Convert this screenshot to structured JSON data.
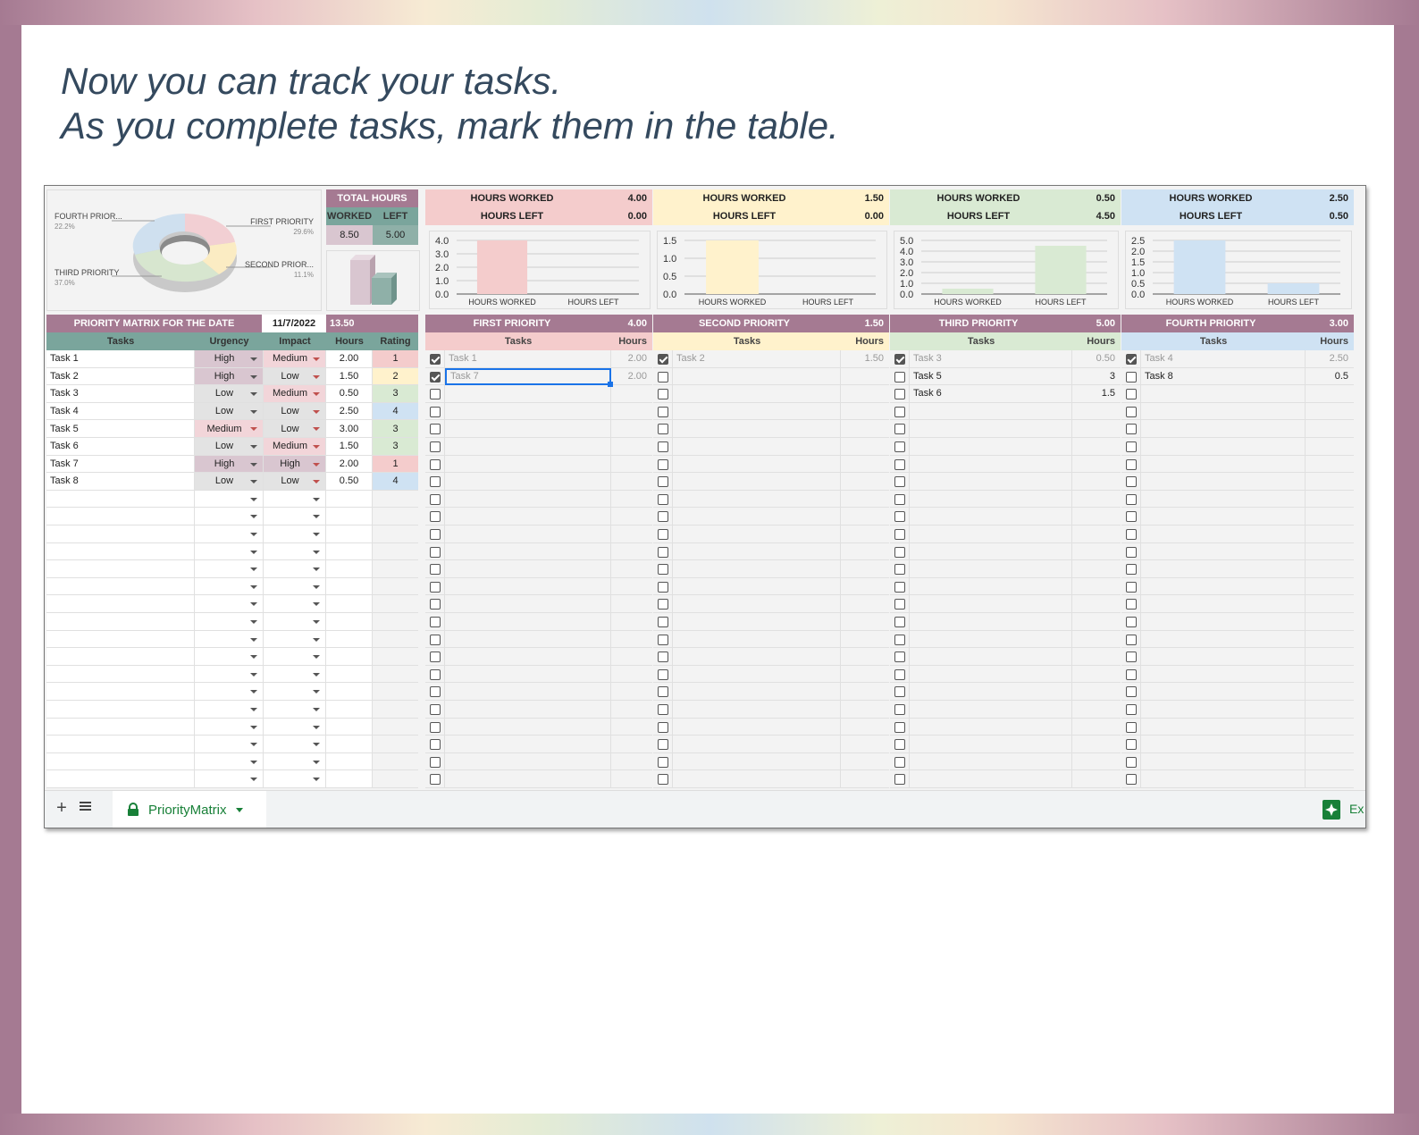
{
  "headline": {
    "line1": "Now you can track your tasks.",
    "line2": "As you complete tasks, mark them in the table."
  },
  "colors": {
    "frame": "#a57a92",
    "headline": "#34495e",
    "header_purple": "#a57a92",
    "header_teal": "#7aa59c",
    "first": "#f4cccc",
    "second": "#fff2cc",
    "third": "#d9ead3",
    "fourth": "#cfe2f3"
  },
  "donut": {
    "labels": [
      {
        "name": "FOURTH PRIOR...",
        "pct": "22.2%"
      },
      {
        "name": "FIRST PRIORITY",
        "pct": "29.6%"
      },
      {
        "name": "SECOND PRIOR...",
        "pct": "11.1%"
      },
      {
        "name": "THIRD PRIORITY",
        "pct": "37.0%"
      }
    ]
  },
  "total_hours": {
    "title": "TOTAL HOURS",
    "worked_label": "WORKED",
    "left_label": "LEFT",
    "worked": "8.50",
    "left": "5.00"
  },
  "summaries": [
    {
      "worked_label": "HOURS WORKED",
      "worked": "4.00",
      "left_label": "HOURS LEFT",
      "left": "0.00"
    },
    {
      "worked_label": "HOURS WORKED",
      "worked": "1.50",
      "left_label": "HOURS LEFT",
      "left": "0.00"
    },
    {
      "worked_label": "HOURS WORKED",
      "worked": "0.50",
      "left_label": "HOURS LEFT",
      "left": "4.50"
    },
    {
      "worked_label": "HOURS WORKED",
      "worked": "2.50",
      "left_label": "HOURS LEFT",
      "left": "0.50"
    }
  ],
  "chart_data": [
    {
      "type": "bar",
      "categories": [
        "HOURS WORKED",
        "HOURS LEFT"
      ],
      "values": [
        4.0,
        0.0
      ],
      "ticks": [
        "4.0",
        "3.0",
        "2.0",
        "1.0",
        "0.0"
      ],
      "ylim": [
        0,
        4.0
      ],
      "grid": true
    },
    {
      "type": "bar",
      "categories": [
        "HOURS WORKED",
        "HOURS LEFT"
      ],
      "values": [
        1.5,
        0.0
      ],
      "ticks": [
        "1.5",
        "1.0",
        "0.5",
        "0.0"
      ],
      "ylim": [
        0,
        1.5
      ],
      "grid": true
    },
    {
      "type": "bar",
      "categories": [
        "HOURS WORKED",
        "HOURS LEFT"
      ],
      "values": [
        0.5,
        4.5
      ],
      "ticks": [
        "5.0",
        "4.0",
        "3.0",
        "2.0",
        "1.0",
        "0.0"
      ],
      "ylim": [
        0,
        5.0
      ],
      "grid": true
    },
    {
      "type": "bar",
      "categories": [
        "HOURS WORKED",
        "HOURS LEFT"
      ],
      "values": [
        2.5,
        0.5
      ],
      "ticks": [
        "2.5",
        "2.0",
        "1.5",
        "1.0",
        "0.5",
        "0.0"
      ],
      "ylim": [
        0,
        2.5
      ],
      "grid": true
    }
  ],
  "matrix": {
    "title": "PRIORITY MATRIX FOR THE DATE",
    "date": "11/7/2022",
    "total": "13.50",
    "columns": [
      "Tasks",
      "Urgency",
      "Impact",
      "Hours",
      "Rating"
    ],
    "rows": [
      {
        "task": "Task 1",
        "urgency": "High",
        "impact": "Medium",
        "hours": "2.00",
        "rating": "1"
      },
      {
        "task": "Task 2",
        "urgency": "High",
        "impact": "Low",
        "hours": "1.50",
        "rating": "2"
      },
      {
        "task": "Task 3",
        "urgency": "Low",
        "impact": "Medium",
        "hours": "0.50",
        "rating": "3"
      },
      {
        "task": "Task 4",
        "urgency": "Low",
        "impact": "Low",
        "hours": "2.50",
        "rating": "4"
      },
      {
        "task": "Task 5",
        "urgency": "Medium",
        "impact": "Low",
        "hours": "3.00",
        "rating": "3"
      },
      {
        "task": "Task 6",
        "urgency": "Low",
        "impact": "Medium",
        "hours": "1.50",
        "rating": "3"
      },
      {
        "task": "Task 7",
        "urgency": "High",
        "impact": "High",
        "hours": "2.00",
        "rating": "1"
      },
      {
        "task": "Task 8",
        "urgency": "Low",
        "impact": "Low",
        "hours": "0.50",
        "rating": "4"
      }
    ]
  },
  "priorities": [
    {
      "title": "FIRST PRIORITY",
      "total": "4.00",
      "col_tasks": "Tasks",
      "col_hours": "Hours",
      "items": [
        {
          "task": "Task 1",
          "hours": "2.00",
          "done": true
        },
        {
          "task": "Task 7",
          "hours": "2.00",
          "done": true
        }
      ]
    },
    {
      "title": "SECOND PRIORITY",
      "total": "1.50",
      "col_tasks": "Tasks",
      "col_hours": "Hours",
      "items": [
        {
          "task": "Task 2",
          "hours": "1.50",
          "done": true
        }
      ]
    },
    {
      "title": "THIRD PRIORITY",
      "total": "5.00",
      "col_tasks": "Tasks",
      "col_hours": "Hours",
      "items": [
        {
          "task": "Task 3",
          "hours": "0.50",
          "done": true
        },
        {
          "task": "Task 5",
          "hours": "3",
          "done": false
        },
        {
          "task": "Task 6",
          "hours": "1.5",
          "done": false
        }
      ]
    },
    {
      "title": "FOURTH PRIORITY",
      "total": "3.00",
      "col_tasks": "Tasks",
      "col_hours": "Hours",
      "items": [
        {
          "task": "Task 4",
          "hours": "2.50",
          "done": true
        },
        {
          "task": "Task 8",
          "hours": "0.5",
          "done": false
        }
      ]
    }
  ],
  "tabbar": {
    "add_icon": "plus-icon",
    "list_icon": "list-icon",
    "sheet_name": "PriorityMatrix",
    "lock_icon": "lock-icon",
    "explore_label": "Ex"
  }
}
